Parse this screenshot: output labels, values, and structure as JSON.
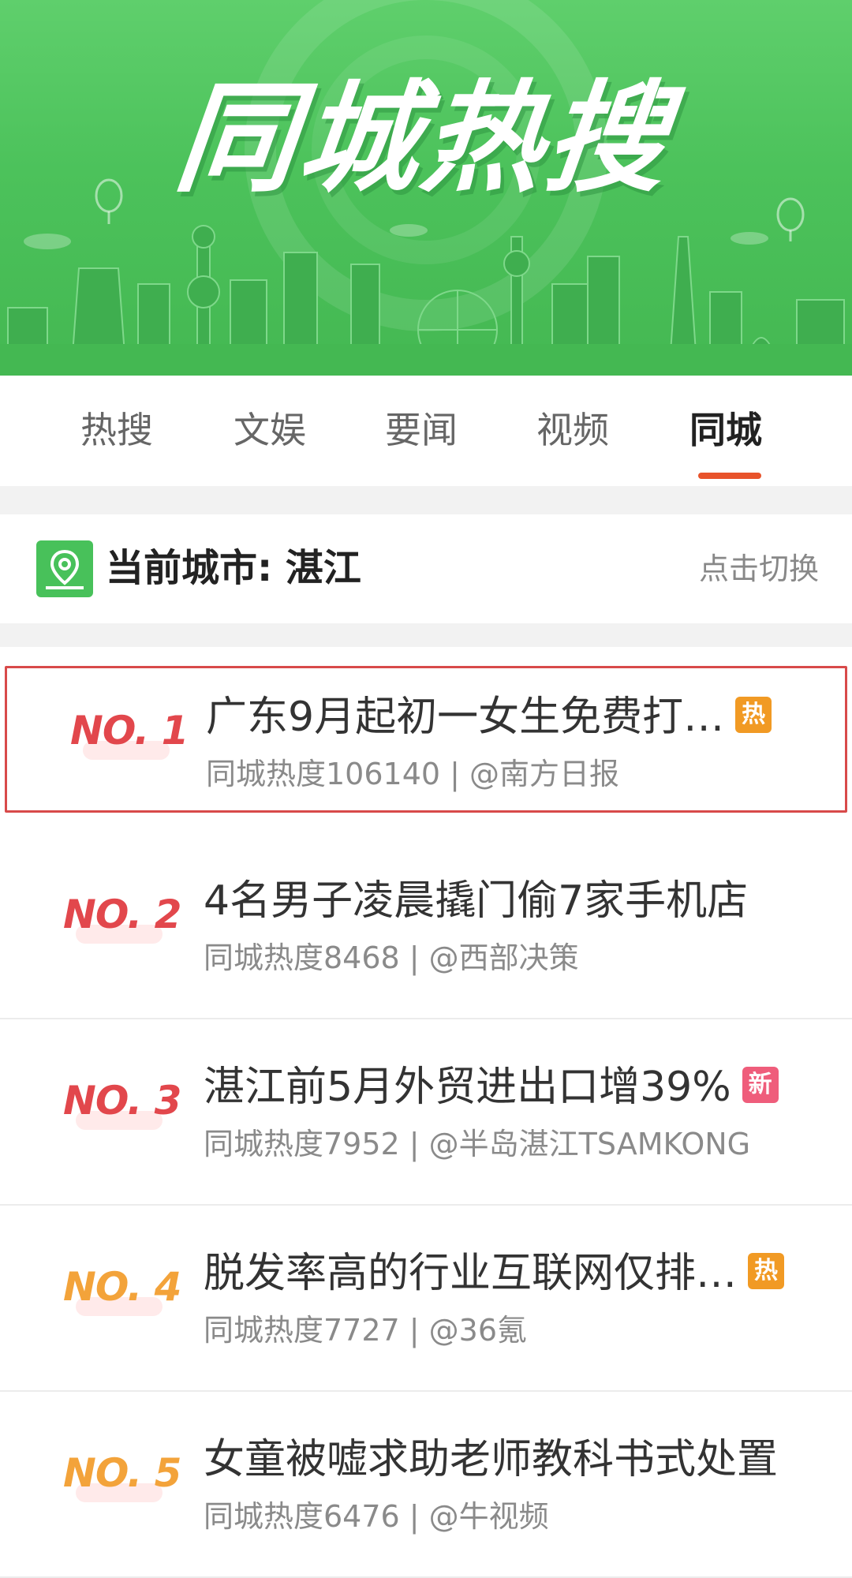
{
  "banner": {
    "title": "同城热搜",
    "colors": {
      "background": "#4cc25b",
      "skyline": "#3fae4f"
    }
  },
  "tabs": [
    {
      "label": "热搜",
      "active": false
    },
    {
      "label": "文娱",
      "active": false
    },
    {
      "label": "要闻",
      "active": false
    },
    {
      "label": "视频",
      "active": false
    },
    {
      "label": "同城",
      "active": true
    }
  ],
  "city_bar": {
    "label": "当前城市: 湛江",
    "switch_label": "点击切换",
    "icon": "map-location-icon"
  },
  "list": [
    {
      "rank": "NO. 1",
      "title": "广东9月起初一女生免费打…",
      "meta": "同城热度106140 | @南方日报",
      "badge": "热",
      "badge_color": "#f19a24",
      "rank_color": "#e2474c",
      "highlighted": true
    },
    {
      "rank": "NO. 2",
      "title": "4名男子凌晨撬门偷7家手机店",
      "meta": "同城热度8468 | @西部决策",
      "badge": "",
      "badge_color": "",
      "rank_color": "#e2474c",
      "highlighted": false
    },
    {
      "rank": "NO. 3",
      "title": "湛江前5月外贸进出口增39%",
      "meta": "同城热度7952 | @半岛湛江TSAMKONG",
      "badge": "新",
      "badge_color": "#ef5d7b",
      "rank_color": "#e2474c",
      "highlighted": false
    },
    {
      "rank": "NO. 4",
      "title": "脱发率高的行业互联网仅排…",
      "meta": "同城热度7727 | @36氪",
      "badge": "热",
      "badge_color": "#f19a24",
      "rank_color": "#f3a33a",
      "highlighted": false
    },
    {
      "rank": "NO. 5",
      "title": "女童被嘘求助老师教科书式处置",
      "meta": "同城热度6476 | @牛视频",
      "badge": "",
      "badge_color": "",
      "rank_color": "#f3a33a",
      "highlighted": false
    }
  ],
  "colors": {
    "accent": "#e8532b",
    "hot_badge": "#f19a24",
    "new_badge": "#ef5d7b"
  }
}
